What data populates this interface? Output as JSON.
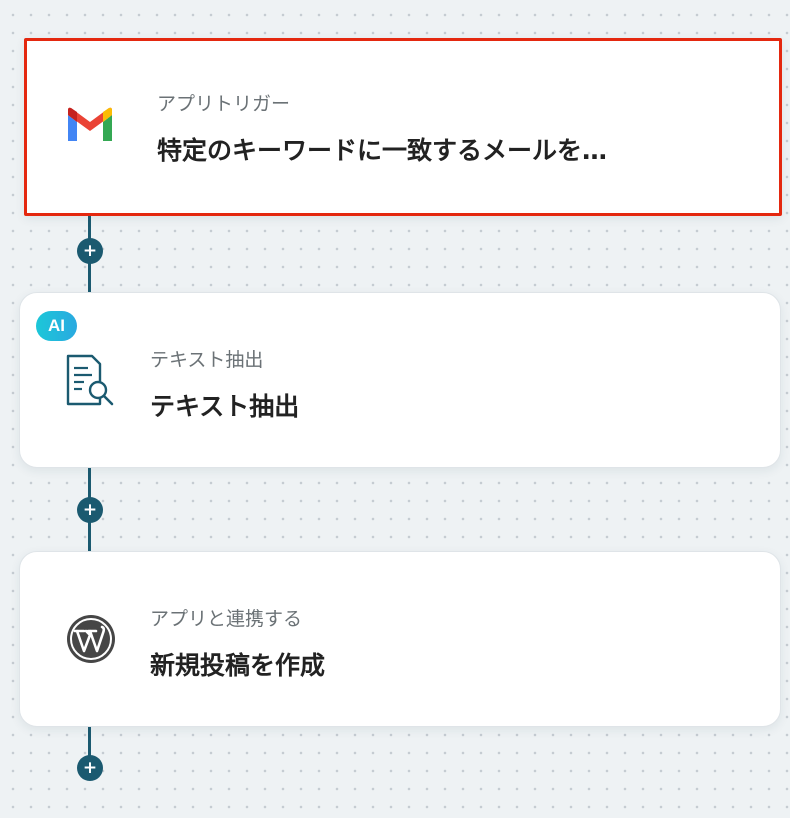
{
  "flow": {
    "steps": [
      {
        "type_label": "アプリトリガー",
        "title": "特定のキーワードに一致するメールを…",
        "icon": "gmail-icon",
        "selected": true
      },
      {
        "badge": "AI",
        "type_label": "テキスト抽出",
        "title": "テキスト抽出",
        "icon": "text-extract-icon"
      },
      {
        "type_label": "アプリと連携する",
        "title": "新規投稿を作成",
        "icon": "wordpress-icon"
      }
    ],
    "add_step_symbol": "+"
  },
  "colors": {
    "connector": "#1b5a70",
    "selected_border": "#e4280f",
    "ai_badge": "#1cc7d8"
  }
}
